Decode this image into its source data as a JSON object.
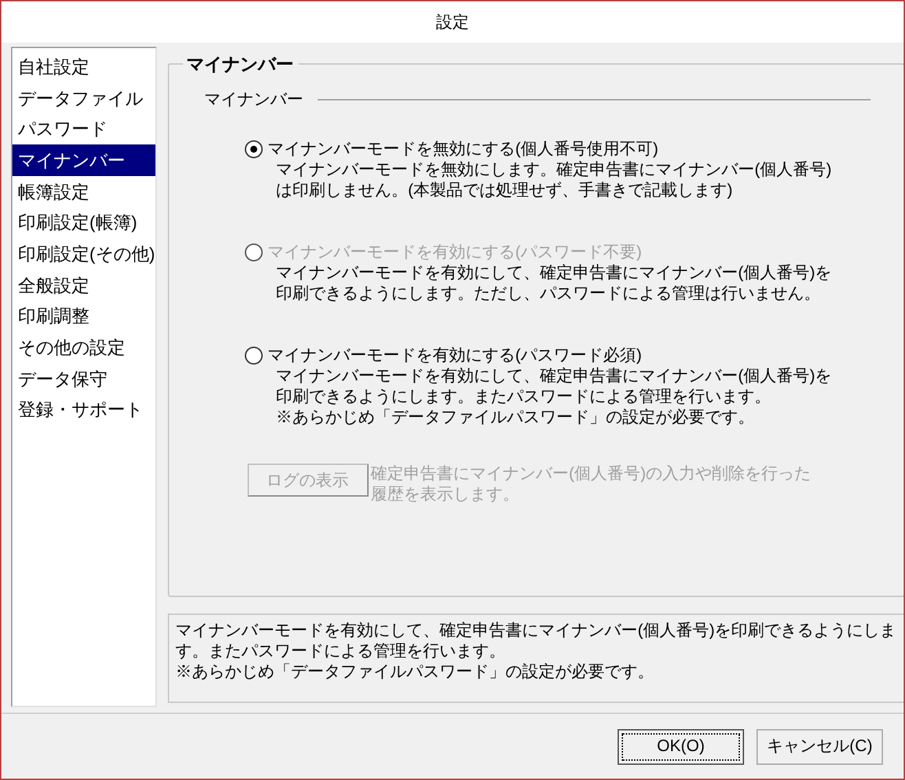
{
  "window": {
    "title": "設定"
  },
  "sidebar": {
    "items": [
      {
        "label": "自社設定",
        "selected": false
      },
      {
        "label": "データファイル",
        "selected": false
      },
      {
        "label": "パスワード",
        "selected": false
      },
      {
        "label": "マイナンバー",
        "selected": true
      },
      {
        "label": "帳簿設定",
        "selected": false
      },
      {
        "label": "印刷設定(帳簿)",
        "selected": false
      },
      {
        "label": "印刷設定(その他)",
        "selected": false
      },
      {
        "label": "全般設定",
        "selected": false
      },
      {
        "label": "印刷調整",
        "selected": false
      },
      {
        "label": "その他の設定",
        "selected": false
      },
      {
        "label": "データ保守",
        "selected": false
      },
      {
        "label": "登録・サポート",
        "selected": false
      }
    ]
  },
  "group": {
    "title": "マイナンバー",
    "section": "マイナンバー",
    "options": [
      {
        "label": "マイナンバーモードを無効にする(個人番号使用不可)",
        "selected": true,
        "disabled": false,
        "description": [
          "マイナンバーモードを無効にします。確定申告書にマイナンバー(個人番号)",
          "は印刷しません。(本製品では処理せず、手書きで記載します)"
        ]
      },
      {
        "label": "マイナンバーモードを有効にする(パスワード不要)",
        "selected": false,
        "disabled": true,
        "description": [
          "マイナンバーモードを有効にして、確定申告書にマイナンバー(個人番号)を",
          "印刷できるようにします。ただし、パスワードによる管理は行いません。"
        ]
      },
      {
        "label": "マイナンバーモードを有効にする(パスワード必須)",
        "selected": false,
        "disabled": false,
        "description": [
          "マイナンバーモードを有効にして、確定申告書にマイナンバー(個人番号)を",
          "印刷できるようにします。またパスワードによる管理を行います。",
          "※あらかじめ「データファイルパスワード」の設定が必要です。"
        ]
      }
    ],
    "log_button": {
      "label": "ログの表示",
      "disabled": true,
      "description": [
        "確定申告書にマイナンバー(個人番号)の入力や削除を行った",
        "履歴を表示します。"
      ]
    }
  },
  "help": [
    "マイナンバーモードを有効にして、確定申告書にマイナンバー(個人番号)を印刷できるようにしま",
    "す。またパスワードによる管理を行います。",
    "※あらかじめ「データファイルパスワード」の設定が必要です。"
  ],
  "buttons": [
    {
      "label": "OK(O)",
      "default": true
    },
    {
      "label": "キャンセル(C)",
      "default": false
    }
  ]
}
